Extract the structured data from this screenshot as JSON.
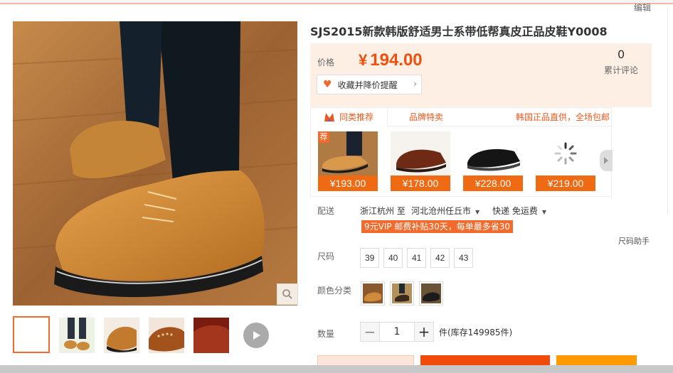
{
  "header": {
    "edit_label": "编辑"
  },
  "product": {
    "title": "SJS2015新款韩版舒适男士系带低帮真皮正品皮鞋Y0008",
    "price_label": "价格",
    "currency": "¥",
    "price": "194.00",
    "review_count": "0",
    "review_label": "累计评论",
    "fav_button": "收藏并降价提醒"
  },
  "recommend": {
    "tabs": [
      "同类推荐",
      "品牌特卖",
      "韩国正品直供，全场包邮"
    ],
    "badge": "荐",
    "items": [
      {
        "price": "¥193.00"
      },
      {
        "price": "¥178.00"
      },
      {
        "price": "¥228.00"
      },
      {
        "price": "¥219.00"
      }
    ]
  },
  "shipping": {
    "label": "配送",
    "from": "浙江杭州 至",
    "to": "河北沧州任丘市",
    "method": "快递 免运费",
    "vip_banner": "9元VIP 邮费补贴30天，每单最多省30"
  },
  "size": {
    "label": "尺码",
    "help": "尺码助手",
    "options": [
      "39",
      "40",
      "41",
      "42",
      "43"
    ]
  },
  "color": {
    "label": "颜色分类"
  },
  "quantity": {
    "label": "数量",
    "minus": "−",
    "plus": "+",
    "value": "1",
    "stock": "件(库存149985件)"
  },
  "colors": {
    "accent": "#f26b2c",
    "price": "#f0500d",
    "price_box": "#fdefe4"
  }
}
